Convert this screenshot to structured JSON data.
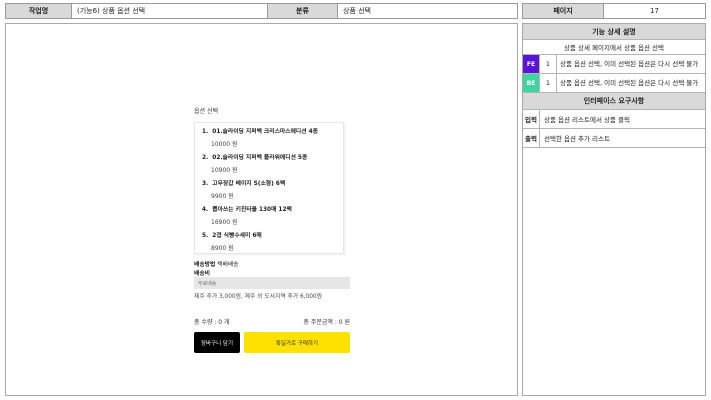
{
  "header": {
    "work_label": "작업명",
    "work_value": "(기능6) 상품 옵션 선택",
    "category_label": "분류",
    "category_value": "상품 선택",
    "page_label": "페이지",
    "page_value": "17"
  },
  "spec": {
    "detail_title": "기능 상세 설명",
    "detail_desc": "상품 상세 페이지에서 상품 옵션 선택",
    "rows": [
      {
        "tag": "FE",
        "num": "1",
        "text": "상품 옵션 선택, 이미 선택된 옵션은 다시 선택 불가"
      },
      {
        "tag": "BE",
        "num": "1",
        "text": "상품 옵션 선택, 이미 선택된 옵션은 다시 선택 불가"
      }
    ],
    "interface_title": "인터페이스 요구사항",
    "input_label": "입력",
    "input_value": "상품 옵션 리스트에서 상품 클릭",
    "output_label": "출력",
    "output_value": "선택한 옵션 추가 리스트"
  },
  "screen": {
    "option_title": "옵션 선택",
    "options": [
      {
        "name": "01.슬라이딩 지퍼백 크리스마스에디션 4종",
        "price": "10000 원"
      },
      {
        "name": "02.슬라이딩 지퍼백 플라워에디션 5종",
        "price": "10900 원"
      },
      {
        "name": "고무장갑 베이지 S(소형) 6팩",
        "price": "9900 원"
      },
      {
        "name": "뽑아쓰는 키친타올 130매 12팩",
        "price": "16900 원"
      },
      {
        "name": "2겹 식빵수세미 6매",
        "price": "8900 원"
      }
    ],
    "shipping_method_label": "배송방법",
    "shipping_method_value": "택배배송",
    "shipping_fee_label": "배송비",
    "shipping_fee_value": "무료배송",
    "shipping_note": "제주 추가 3,000원, 제주 외 도서지역 추가 6,000원",
    "quantity": "총 수량 : 0 개",
    "total_price": "총 주문금액 : 0 원",
    "cart_button": "장바구니 담기",
    "buy_button": "톡딜가로 구매하기"
  }
}
